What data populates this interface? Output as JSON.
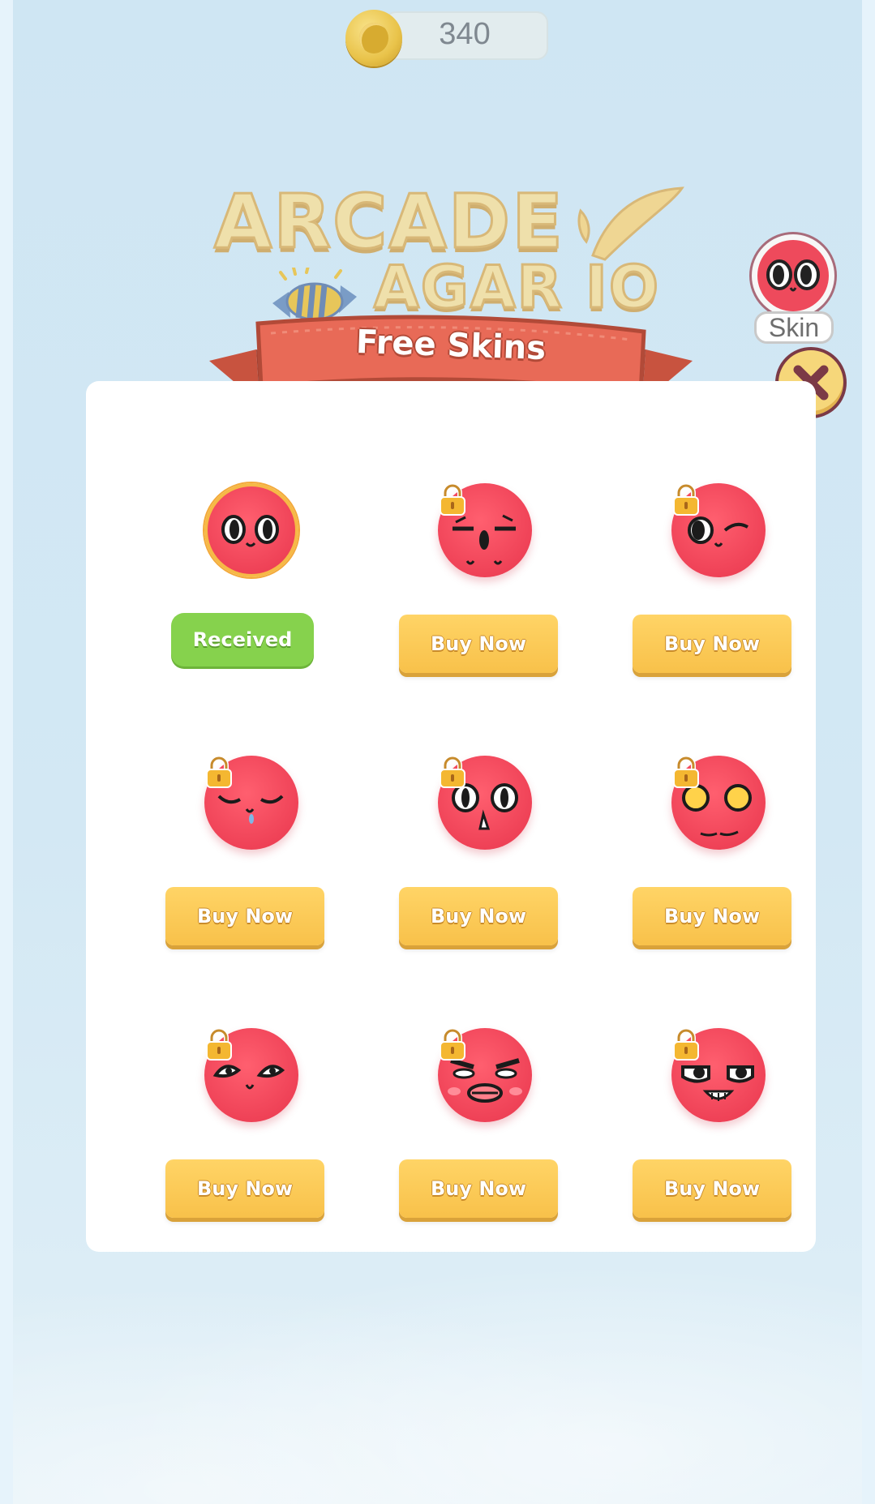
{
  "wallet": {
    "coins": "340",
    "coin_icon": "bean-coin-icon"
  },
  "logo": {
    "line1": "ARCADE",
    "line2": "AGAR IO"
  },
  "banner": {
    "title": "Free Skins"
  },
  "side": {
    "skin_label": "Skin",
    "close_icon": "close-x-icon"
  },
  "colors": {
    "buy": "#f8c14a",
    "received": "#86d24d",
    "ball": "#ef4257",
    "ribbon": "#e86a57"
  },
  "skins": [
    {
      "face": "big-eyes-smile",
      "status": "Received",
      "locked": false
    },
    {
      "face": "sleepy-shout",
      "status": "Buy Now",
      "locked": true
    },
    {
      "face": "wink",
      "status": "Buy Now",
      "locked": true
    },
    {
      "face": "sleepy-drool",
      "status": "Buy Now",
      "locked": true
    },
    {
      "face": "surprised",
      "status": "Buy Now",
      "locked": true
    },
    {
      "face": "yellow-eyes",
      "status": "Buy Now",
      "locked": true
    },
    {
      "face": "sly",
      "status": "Buy Now",
      "locked": true
    },
    {
      "face": "angry-lips",
      "status": "Buy Now",
      "locked": true
    },
    {
      "face": "grin",
      "status": "Buy Now",
      "locked": true
    }
  ]
}
